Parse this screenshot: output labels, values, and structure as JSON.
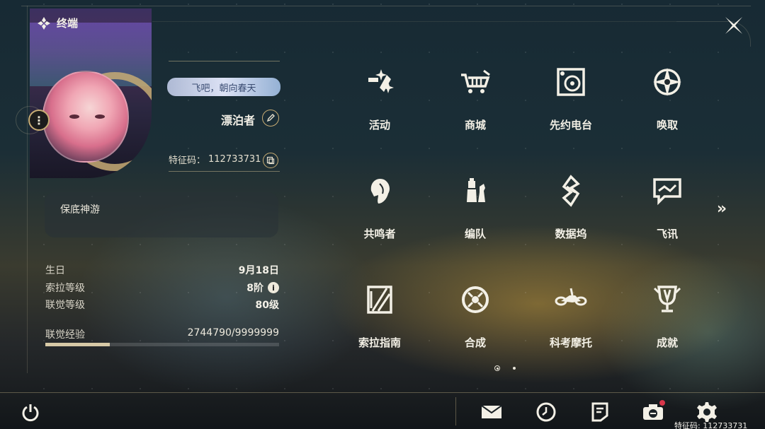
{
  "header": {
    "title": "终端"
  },
  "profile": {
    "signature": "飞吧，朝向春天",
    "nickname": "漂泊者",
    "uid_label": "特征码：",
    "uid": "112733731"
  },
  "guarantee": {
    "label": "保底神游"
  },
  "stats": {
    "birthday_label": "生日",
    "birthday": "9月18日",
    "sol_rank_label": "索拉等级",
    "sol_rank": "8阶",
    "union_level_label": "联觉等级",
    "union_level": "80级",
    "union_exp_label": "联觉经验",
    "union_exp": "2744790/9999999",
    "union_exp_fraction": 0.2745
  },
  "menu": {
    "items": [
      {
        "label": "活动",
        "icon": "sparkle-icon"
      },
      {
        "label": "商城",
        "icon": "cart-icon"
      },
      {
        "label": "先约电台",
        "icon": "radio-icon"
      },
      {
        "label": "唤取",
        "icon": "compass-star-icon"
      },
      {
        "label": "共鸣者",
        "icon": "resonator-head-icon"
      },
      {
        "label": "编队",
        "icon": "team-chess-icon"
      },
      {
        "label": "数据坞",
        "icon": "data-bank-icon"
      },
      {
        "label": "飞讯",
        "icon": "chat-icon"
      },
      {
        "label": "索拉指南",
        "icon": "guide-book-icon"
      },
      {
        "label": "合成",
        "icon": "synthesis-icon"
      },
      {
        "label": "科考摩托",
        "icon": "motorcycle-icon"
      },
      {
        "label": "成就",
        "icon": "trophy-icon"
      }
    ],
    "next_page": "»",
    "page_count": 2,
    "current_page": 1
  },
  "bottom_bar": {
    "buttons": [
      "power-icon",
      "mail-icon",
      "clock-icon",
      "notes-icon",
      "camera-icon",
      "settings-icon"
    ]
  },
  "watermark": "特征码: 112733731",
  "colors": {
    "accent_gold": "#c7ac74",
    "notification": "#d9364a"
  }
}
